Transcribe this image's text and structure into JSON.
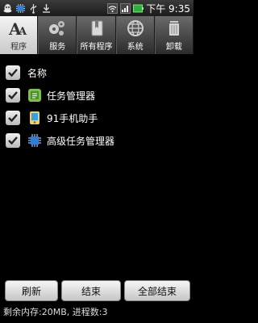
{
  "status_bar": {
    "time": "下午 9:35",
    "icons": [
      "qq-icon",
      "chip-icon",
      "usb-icon",
      "download-icon",
      "wifi-icon",
      "signal-icon",
      "battery-icon"
    ]
  },
  "tabs": [
    {
      "label": "程序",
      "icon": "aa-icon",
      "active": true
    },
    {
      "label": "服务",
      "icon": "gears-icon",
      "active": false
    },
    {
      "label": "所有程序",
      "icon": "book-icon",
      "active": false
    },
    {
      "label": "系统",
      "icon": "globe-icon",
      "active": false
    },
    {
      "label": "卸载",
      "icon": "trash-icon",
      "active": false
    }
  ],
  "list": {
    "header_label": "名称",
    "items": [
      {
        "name": "任务管理器",
        "icon": "task-manager-icon"
      },
      {
        "name": "91手机助手",
        "icon": "assistant-91-icon"
      },
      {
        "name": "高级任务管理器",
        "icon": "advanced-task-manager-icon"
      }
    ]
  },
  "buttons": {
    "refresh": "刷新",
    "end": "结束",
    "end_all": "全部结束"
  },
  "footer": {
    "text": "剩余内存:20MB, 进程数:3"
  },
  "colors": {
    "accent": "#3c7ab3",
    "status_green": "#2eae3a"
  }
}
